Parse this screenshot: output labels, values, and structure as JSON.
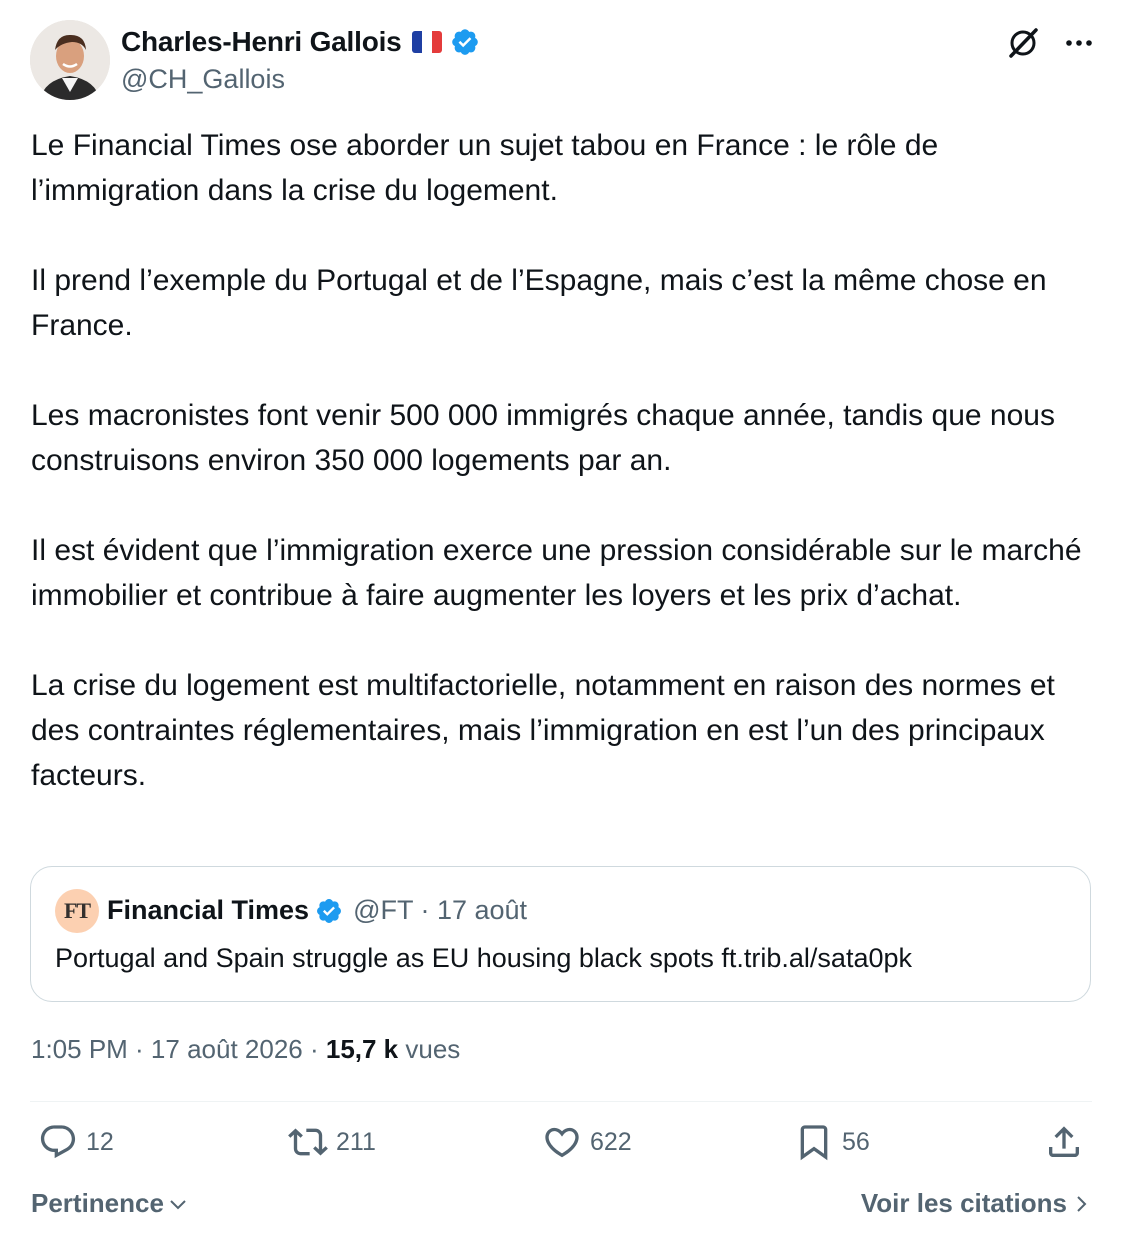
{
  "author": {
    "display_name": "Charles-Henri Gallois",
    "handle": "@CH_Gallois",
    "flag": "france-flag",
    "verified": true,
    "avatar_icon": "profile-photo"
  },
  "post": {
    "paragraphs": [
      "Le Financial Times ose aborder un sujet tabou en France : le rôle de l’immigration dans la crise du logement.",
      "Il prend l’exemple du Portugal et de l’Espagne, mais c’est la même chose en France.",
      "Les macronistes font venir 500 000 immigrés chaque année, tandis que nous construisons environ 350 000 logements par an.",
      "Il est évident que l’immigration exerce une pression considérable sur le marché immobilier et contribue à faire augmenter les loyers et les prix d’achat.",
      "La crise du logement est multifactorielle, notamment en raison des normes et des contraintes réglementaires, mais l’immigration en est l’un des principaux facteurs."
    ]
  },
  "quoted": {
    "logo_text": "FT",
    "name": "Financial Times",
    "meta": "@FT · 17 août",
    "text": "Portugal and Spain struggle as EU housing black spots ft.trib.al/sata0pk"
  },
  "meta": {
    "time_date": "1:05 PM · 17 août 2026 · ",
    "views_count": "15,7 k",
    "views_label": " vues"
  },
  "actions": {
    "replies": "12",
    "reposts": "211",
    "likes": "622",
    "bookmarks": "56"
  },
  "footer": {
    "sort_label": "Pertinence",
    "quotes_label": "Voir les citations"
  },
  "colors": {
    "text": "#0f1419",
    "secondary": "#536471",
    "verified_blue": "#1d9bf0",
    "border": "#cfd9de"
  }
}
